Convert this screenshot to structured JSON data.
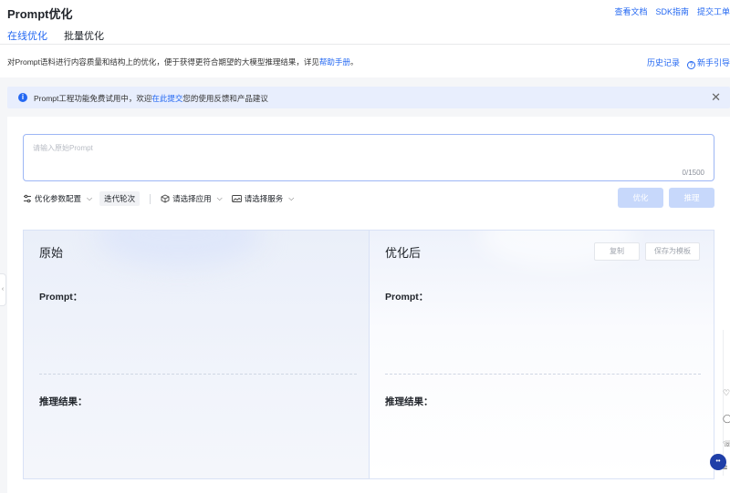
{
  "header": {
    "title": "Prompt优化",
    "links": [
      "查看文档",
      "SDK指南",
      "提交工单"
    ]
  },
  "tabs": [
    {
      "label": "在线优化",
      "active": true
    },
    {
      "label": "批量优化",
      "active": false
    }
  ],
  "description": {
    "text": "对Prompt语料进行内容质量和结构上的优化，便于获得更符合期望的大模型推理结果，详见",
    "link": "帮助手册",
    "suffix": "。",
    "right_links": {
      "history": "历史记录",
      "guide": "新手引导"
    }
  },
  "notice": {
    "prefix": "Prompt工程功能免费试用中，欢迎",
    "link": "在此提交",
    "suffix": "您的使用反馈和产品建议"
  },
  "input": {
    "placeholder": "请输入原始Prompt",
    "counter": "0/1500"
  },
  "toolbar": {
    "params": "优化参数配置",
    "iterations": "迭代轮次",
    "select_app": "请选择应用",
    "select_service": "请选择服务"
  },
  "actions": {
    "optimize": "优化",
    "inference": "推理"
  },
  "panels": {
    "original": {
      "title": "原始",
      "prompt_label": "Prompt：",
      "result_label": "推理结果："
    },
    "optimized": {
      "title": "优化后",
      "copy": "复制",
      "save_template": "保存为模板",
      "prompt_label": "Prompt：",
      "result_label": "推理结果："
    }
  },
  "colors": {
    "accent": "#2468f2",
    "notice_bg": "#e8eefd",
    "disabled_button": "#c7d8fb"
  }
}
